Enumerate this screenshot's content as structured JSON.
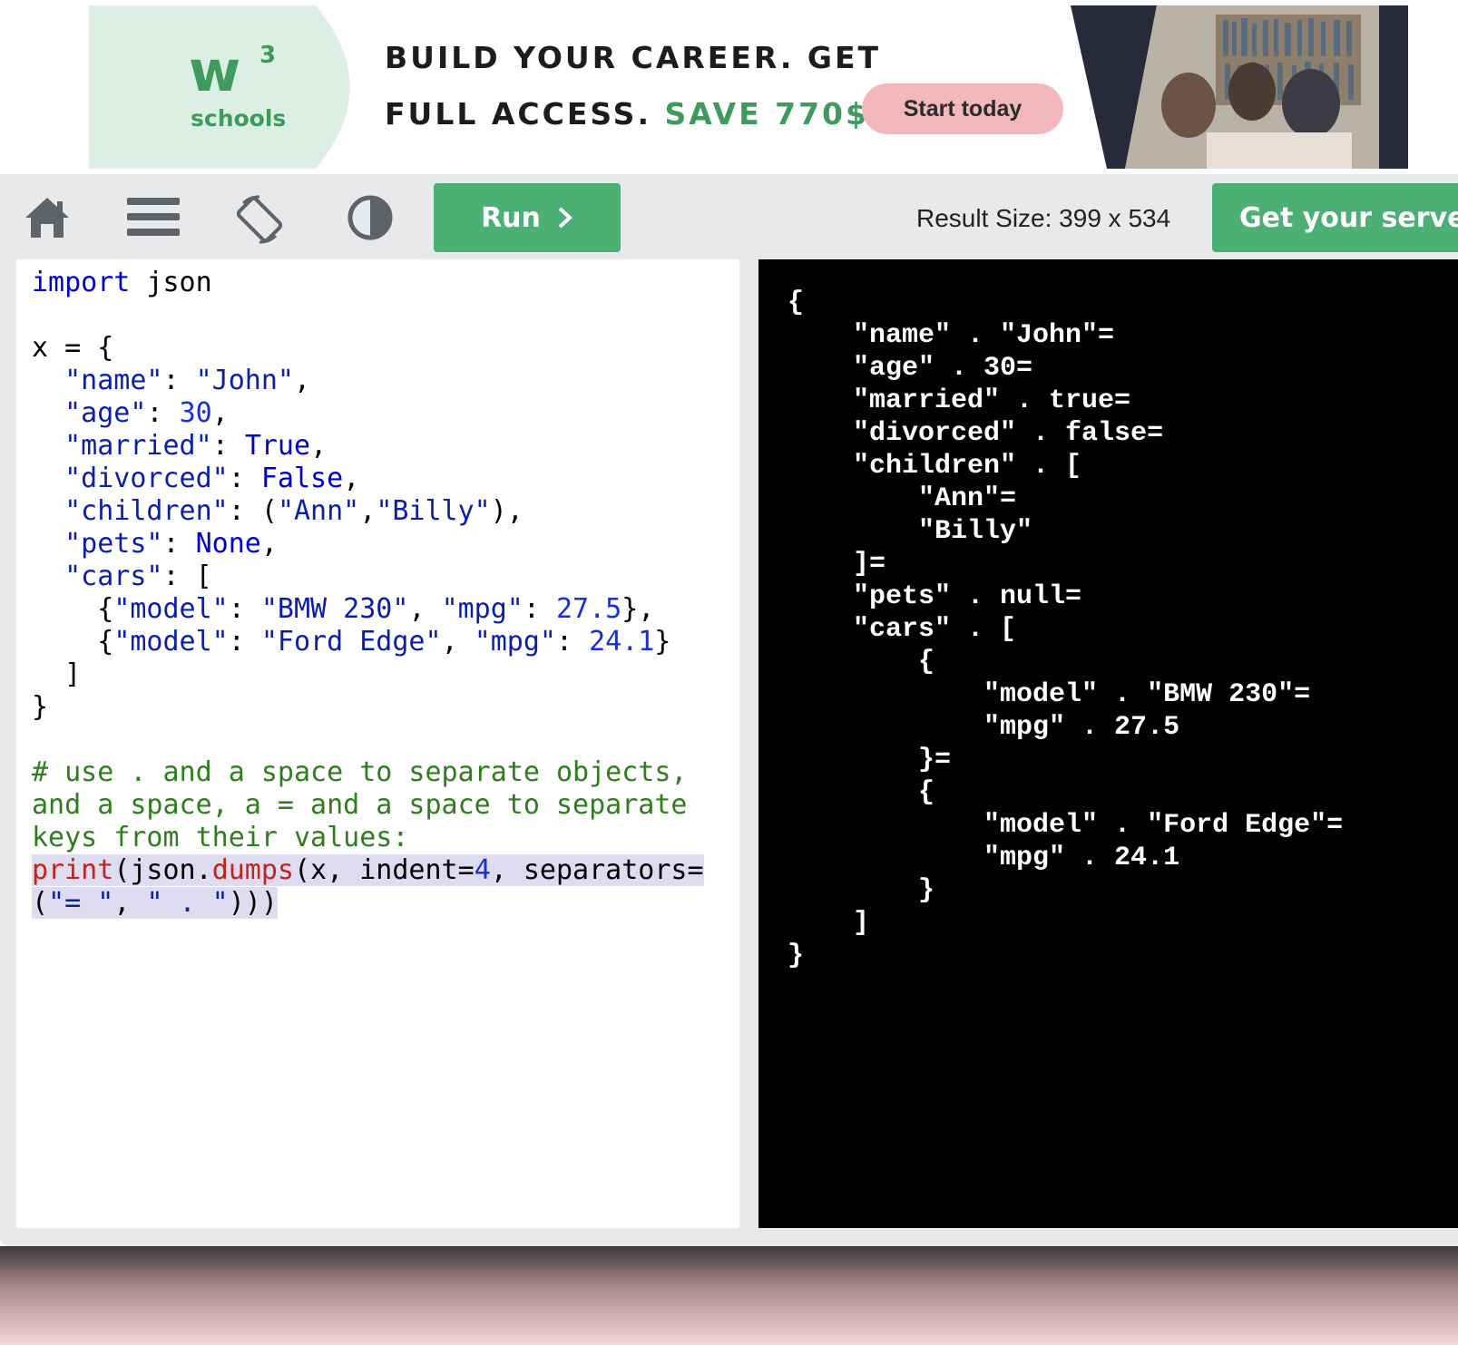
{
  "ad": {
    "logo_mark": "w",
    "logo_superscript": "3",
    "logo_word": "schools",
    "line1": "BUILD YOUR CAREER. GET",
    "line2_prefix": "FULL ACCESS. ",
    "line2_accent": "SAVE 770$",
    "cta_label": "Start today",
    "accent_color": "#3f9a5e",
    "cta_color": "#f2b8be"
  },
  "toolbar": {
    "icons": [
      "home-icon",
      "menu-icon",
      "rotate-icon",
      "contrast-icon"
    ],
    "run_label": "Run",
    "run_icon": "chevron-right-icon",
    "result_size": "Result Size: 399 x 534",
    "server_label": "Get your server",
    "button_color": "#4caf74"
  },
  "editor": {
    "lines": [
      "import json",
      "",
      "x = {",
      "  \"name\": \"John\",",
      "  \"age\": 30,",
      "  \"married\": True,",
      "  \"divorced\": False,",
      "  \"children\": (\"Ann\",\"Billy\"),",
      "  \"pets\": None,",
      "  \"cars\": [",
      "    {\"model\": \"BMW 230\", \"mpg\": 27.5},",
      "    {\"model\": \"Ford Edge\", \"mpg\": 24.1}",
      "  ]",
      "}",
      "",
      "# use . and a space to separate objects,",
      "and a space, a = and a space to separate",
      "keys from their values:",
      "print(json.dumps(x, indent=4, separators=",
      "(\"= \", \" . \")))"
    ]
  },
  "output": {
    "lines": [
      "{",
      "    \"name\" . \"John\"=",
      "    \"age\" . 30=",
      "    \"married\" . true=",
      "    \"divorced\" . false=",
      "    \"children\" . [",
      "        \"Ann\"=",
      "        \"Billy\"",
      "    ]=",
      "    \"pets\" . null=",
      "    \"cars\" . [",
      "        {",
      "            \"model\" . \"BMW 230\"=",
      "            \"mpg\" . 27.5",
      "        }=",
      "        {",
      "            \"model\" . \"Ford Edge\"=",
      "            \"mpg\" . 24.1",
      "        }",
      "    ]",
      "}"
    ]
  }
}
